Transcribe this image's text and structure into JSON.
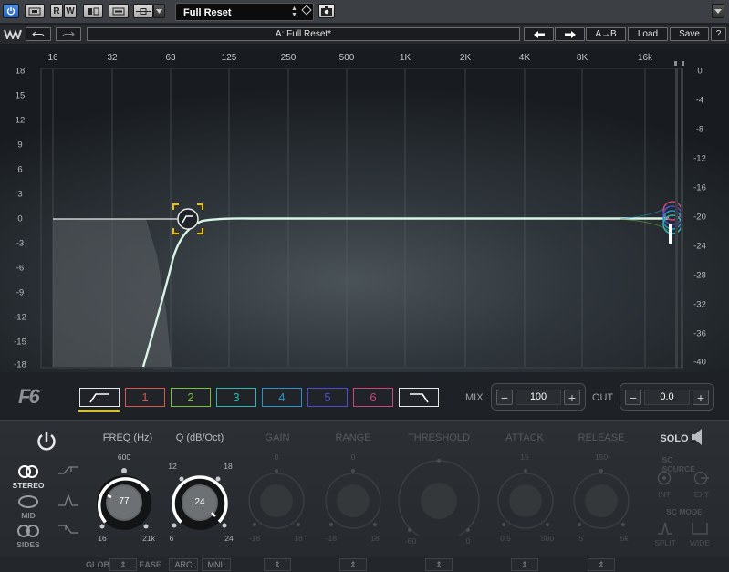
{
  "host": {
    "power_icon": "power-icon",
    "buttons": [
      "R",
      "W"
    ],
    "preset": "Full Reset"
  },
  "toolbar": {
    "title": "A: Full Reset*",
    "ab_label": "A→B",
    "load_label": "Load",
    "save_label": "Save",
    "help_label": "?"
  },
  "graph": {
    "freq_labels": [
      "16",
      "32",
      "63",
      "125",
      "250",
      "500",
      "1K",
      "2K",
      "4K",
      "8K",
      "16k"
    ],
    "gain_labels": [
      "18",
      "15",
      "12",
      "9",
      "6",
      "3",
      "0",
      "-3",
      "-6",
      "-9",
      "-12",
      "-15",
      "-18"
    ],
    "meter_labels": [
      "0",
      "-4",
      "-8",
      "-12",
      "-16",
      "-20",
      "-24",
      "-28",
      "-32",
      "-36",
      "-40"
    ]
  },
  "bands": {
    "labels": [
      "1",
      "2",
      "3",
      "4",
      "5",
      "6"
    ],
    "colors": [
      "#d8574e",
      "#7bbf3a",
      "#2fb6b2",
      "#2b93c9",
      "#4b4fcf",
      "#c9477f"
    ],
    "low_cut_color": "#d8c21e"
  },
  "mix": {
    "label": "MIX",
    "value": "100"
  },
  "out": {
    "label": "OUT",
    "value": "0.0"
  },
  "panel": {
    "routing": {
      "stereo": "STEREO",
      "mid": "MID",
      "sides": "SIDES"
    },
    "freq": {
      "label": "FREQ (Hz)",
      "top": "600",
      "min": "16",
      "max": "21k",
      "value": "77"
    },
    "q": {
      "label": "Q (dB/Oct)",
      "left_top": "12",
      "right_top": "18",
      "min": "6",
      "max": "24",
      "value": "24"
    },
    "gain": {
      "label": "GAIN",
      "top": "0",
      "min": "-18",
      "max": "18"
    },
    "range": {
      "label": "RANGE",
      "top": "0",
      "min": "-18",
      "max": "18"
    },
    "threshold": {
      "label": "THRESHOLD",
      "min": "-60",
      "max": "0"
    },
    "attack": {
      "label": "ATTACK",
      "top": "15",
      "min": "0.5",
      "max": "500"
    },
    "release": {
      "label": "RELEASE",
      "top": "150",
      "min": "5",
      "max": "5k"
    },
    "solo": "SOLO",
    "sc_source": {
      "label": "SC SOURCE",
      "int": "INT",
      "ext": "EXT"
    },
    "sc_mode": {
      "label": "SC MODE",
      "split": "SPLIT",
      "wide": "WIDE"
    }
  },
  "global": {
    "label": "GLOBAL RELEASE",
    "arc": "ARC",
    "mnl": "MNL"
  }
}
